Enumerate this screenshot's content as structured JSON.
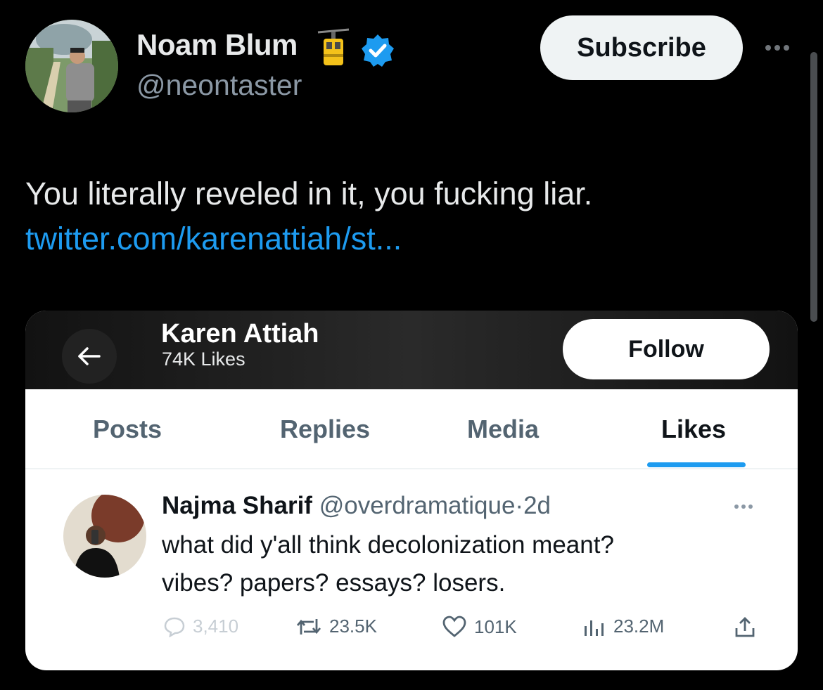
{
  "author": {
    "name": "Noam Blum",
    "handle": "@neontaster",
    "emoji_icon": "aerial-tramway-icon",
    "verified_icon": "verified-badge-icon"
  },
  "subscribe_label": "Subscribe",
  "tweet": {
    "text": "You literally reveled in it, you fucking liar.",
    "link": "twitter.com/karenattiah/st..."
  },
  "embed": {
    "profile_name": "Karen Attiah",
    "profile_likes": "74K Likes",
    "follow_label": "Follow",
    "tabs": [
      "Posts",
      "Replies",
      "Media",
      "Likes"
    ],
    "active_tab": "Likes",
    "post": {
      "name": "Najma Sharif",
      "handle": "@overdramatique",
      "separator": "·",
      "date": "2d",
      "line1": "what did y'all think decolonization meant?",
      "line2": "vibes? papers? essays? losers.",
      "replies": "3,410",
      "reposts": "23.5K",
      "likes": "101K",
      "views": "23.2M"
    }
  },
  "colors": {
    "background": "#000000",
    "link": "#1d9bf0",
    "verified": "#1d9bf0",
    "muted": "#8b98a5"
  }
}
